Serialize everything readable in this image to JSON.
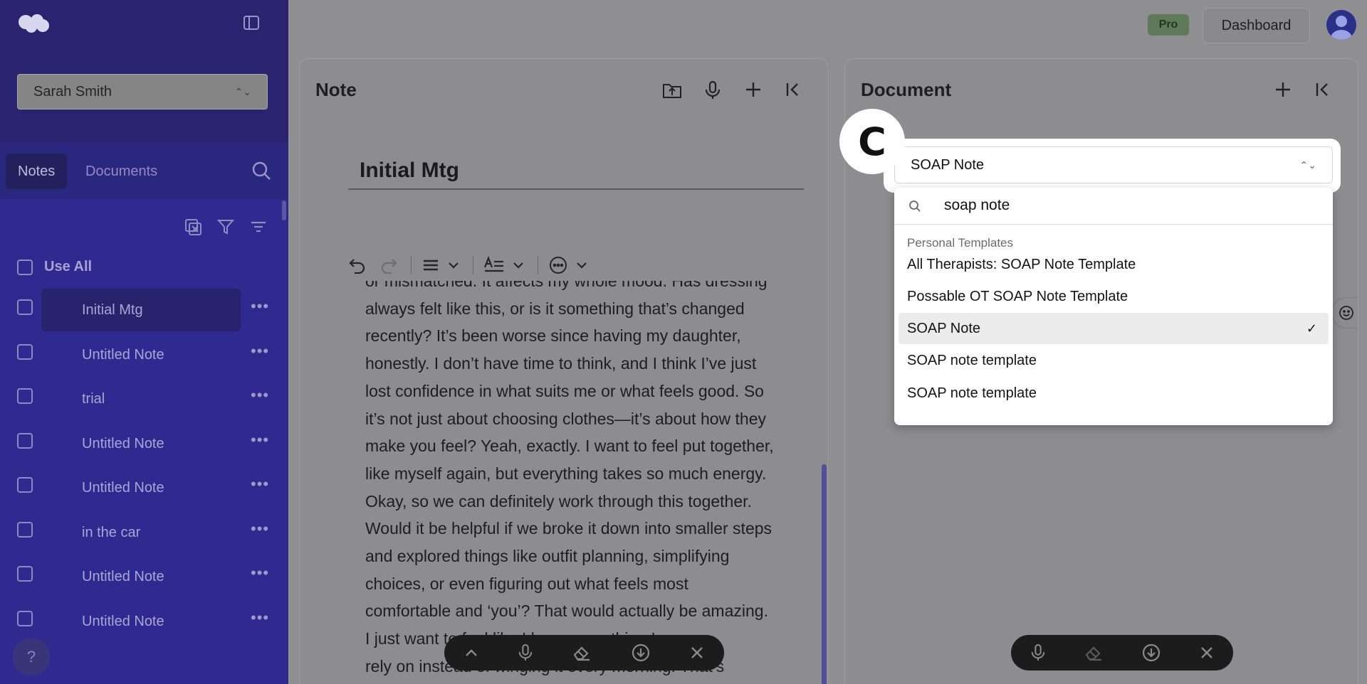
{
  "sidebar": {
    "user_name": "Sarah Smith",
    "tabs": {
      "notes": "Notes",
      "documents": "Documents"
    },
    "use_all_label": "Use All",
    "notes": [
      {
        "label": "Initial Mtg",
        "active": true
      },
      {
        "label": "Untitled Note"
      },
      {
        "label": "trial"
      },
      {
        "label": "Untitled Note"
      },
      {
        "label": "Untitled Note"
      },
      {
        "label": "in the car"
      },
      {
        "label": "Untitled Note"
      },
      {
        "label": "Untitled Note"
      }
    ],
    "help_label": "?"
  },
  "header": {
    "plan_badge": "Pro",
    "dashboard_label": "Dashboard"
  },
  "note_panel": {
    "title": "Note",
    "note_title": "Initial Mtg",
    "body_lines": [
      "or mismatched. It affects my whole mood. Has dressing",
      "always felt like this, or is it something that’s changed",
      "recently? It’s been worse since having my daughter,",
      "honestly. I don’t have time to think, and I think I’ve just",
      "lost confidence in what suits me or what feels good. So",
      "it’s not just about choosing clothes—it’s about how they",
      "make you feel? Yeah, exactly. I want to feel put together,",
      "like myself again, but everything takes so much energy.",
      "Okay, so we can definitely work through this together.",
      "Would it be helpful if we broke it down into smaller steps",
      "and explored things like outfit planning, simplifying",
      "choices, or even figuring out what feels most",
      "comfortable and ‘you’? That would actually be amazing.",
      "I just want to feel like I have something I can",
      "rely on instead of winging it every morning. That’s"
    ]
  },
  "document_panel": {
    "title": "Document",
    "annotation_badge": "C",
    "selected_template": "SOAP Note",
    "search_query": "soap note",
    "group_label": "Personal Templates",
    "options": [
      {
        "label": "All Therapists: SOAP Note Template"
      },
      {
        "label": "Possable OT SOAP Note Template"
      },
      {
        "label": "SOAP Note",
        "selected": true,
        "check": "✓"
      },
      {
        "label": "SOAP note template"
      },
      {
        "label": "SOAP note template"
      }
    ]
  }
}
